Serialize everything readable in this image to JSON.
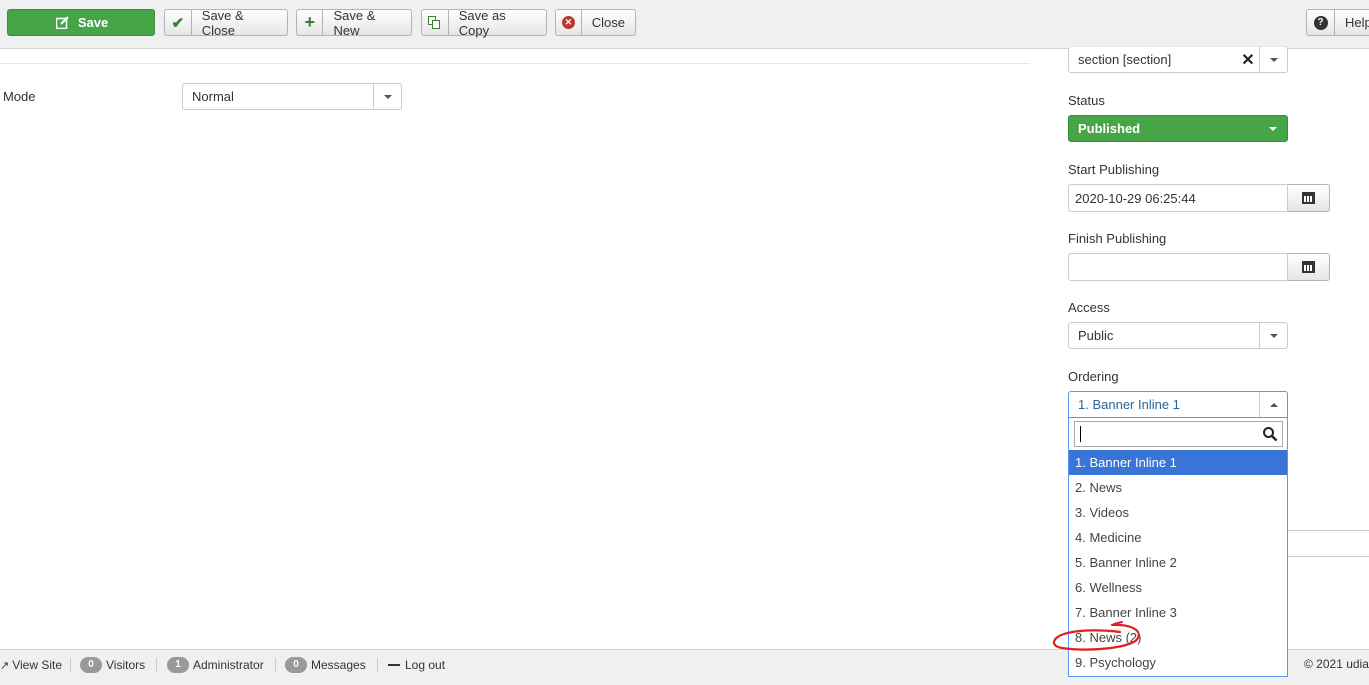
{
  "toolbar": {
    "save": "Save",
    "save_close": "Save & Close",
    "save_new": "Save & New",
    "save_copy": "Save as Copy",
    "close": "Close",
    "help": "Help"
  },
  "main": {
    "mode_label": "Mode",
    "mode_value": "Normal"
  },
  "sidebar": {
    "position_value": "section [section]",
    "status_label": "Status",
    "status_value": "Published",
    "start_label": "Start Publishing",
    "start_value": "2020-10-29 06:25:44",
    "finish_label": "Finish Publishing",
    "finish_value": "",
    "access_label": "Access",
    "access_value": "Public",
    "ordering_label": "Ordering",
    "ordering_value": "1. Banner Inline 1",
    "ordering_options": [
      "1. Banner Inline 1",
      "2. News",
      "3. Videos",
      "4. Medicine",
      "5. Banner Inline 2",
      "6. Wellness",
      "7. Banner Inline 3",
      "8. News (2)",
      "9. Psychology"
    ]
  },
  "statusbar": {
    "view_site": "View Site",
    "visitors_count": "0",
    "visitors": "Visitors",
    "admin_count": "1",
    "admin": "Administrator",
    "messages_count": "0",
    "messages": "Messages",
    "logout": "Log out",
    "copyright": "© 2021 udia"
  },
  "colors": {
    "success": "#46a546",
    "selected": "#3875d7",
    "focus": "#5897fb",
    "annotation": "#e02020"
  }
}
